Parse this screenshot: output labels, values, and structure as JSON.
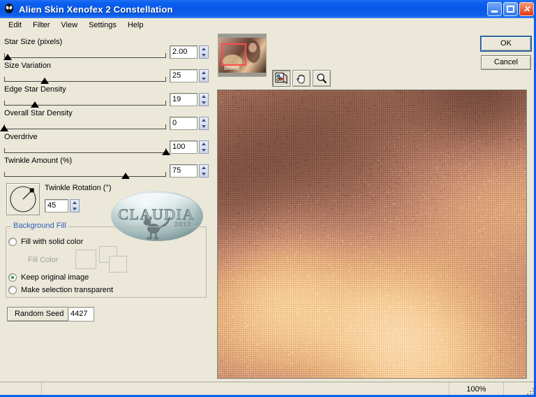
{
  "window": {
    "title": "Alien Skin Xenofex 2 Constellation",
    "icon": "alien-head-icon",
    "titlebar_color": "#0b5ff0",
    "background_color": "#ebe7d9",
    "buttons": {
      "minimize": "minimize-icon",
      "maximize": "maximize-icon",
      "close": "✕"
    }
  },
  "menu": {
    "items": [
      {
        "label": "Edit"
      },
      {
        "label": "Filter"
      },
      {
        "label": "View"
      },
      {
        "label": "Settings"
      },
      {
        "label": "Help"
      }
    ]
  },
  "sliders": [
    {
      "label": "Star Size (pixels)",
      "value": "2.00",
      "thumb_pct": 2
    },
    {
      "label": "Size Variation",
      "value": "25",
      "thumb_pct": 25
    },
    {
      "label": "Edge Star Density",
      "value": "19",
      "thumb_pct": 19
    },
    {
      "label": "Overall Star Density",
      "value": "0",
      "thumb_pct": 0
    },
    {
      "label": "Overdrive",
      "value": "100",
      "thumb_pct": 100
    },
    {
      "label": "Twinkle Amount (%)",
      "value": "75",
      "thumb_pct": 75
    }
  ],
  "rotation": {
    "label": "Twinkle Rotation (°)",
    "value": "45",
    "dial_degrees": 45
  },
  "watermark": {
    "text": "CLAUDIA",
    "year": "2012"
  },
  "background_fill": {
    "title": "Background Fill",
    "options": [
      {
        "label": "Fill with solid color",
        "selected": false
      },
      {
        "label": "Keep original image",
        "selected": true
      },
      {
        "label": "Make selection transparent",
        "selected": false
      }
    ],
    "fill_color_label": "Fill Color",
    "fill_color_enabled": false
  },
  "random_seed": {
    "button_label": "Random Seed",
    "value": "4427"
  },
  "navigator": {
    "name": "navigator-thumbnail",
    "roi": "region-of-interest-rectangle"
  },
  "tools": [
    {
      "name": "compare-preview-icon",
      "pressed": true
    },
    {
      "name": "hand-pan-icon",
      "pressed": false
    },
    {
      "name": "zoom-magnifier-icon",
      "pressed": false
    }
  ],
  "actions": {
    "ok_label": "OK",
    "cancel_label": "Cancel"
  },
  "statusbar": {
    "left": "",
    "middle": "",
    "zoom": "100%",
    "right": ""
  },
  "preview": {
    "description": "copper-gold crosshatch metallic texture"
  }
}
